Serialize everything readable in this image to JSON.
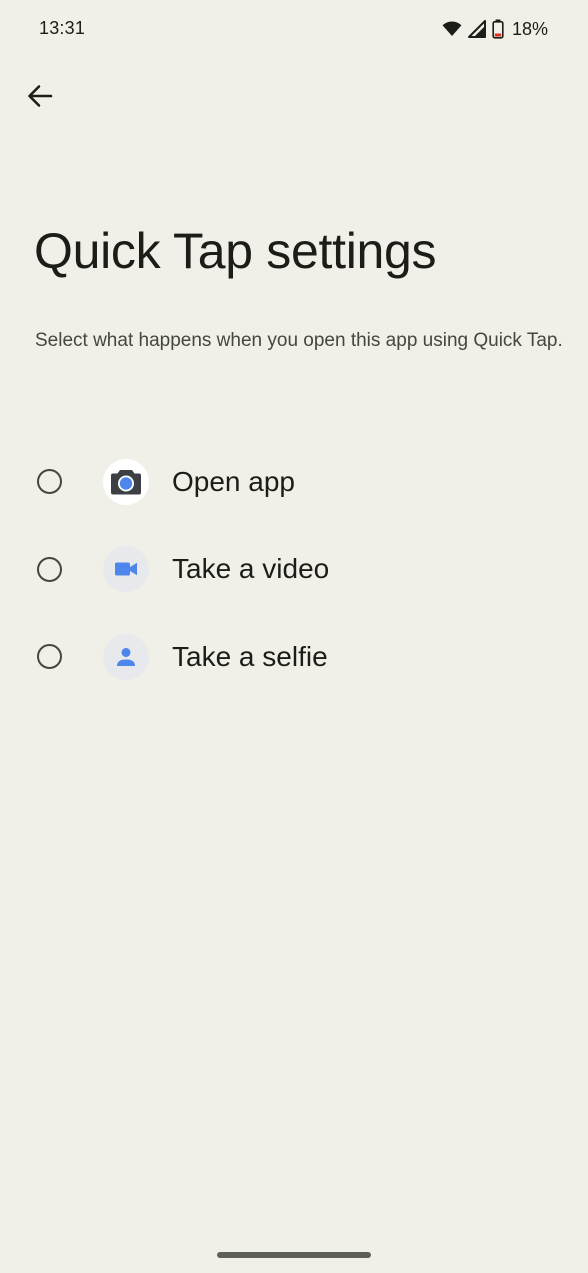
{
  "status_bar": {
    "time": "13:31",
    "battery_percent": "18%",
    "icons": [
      "wifi-icon",
      "cell-signal-icon",
      "battery-low-icon"
    ],
    "battery_color": "#d93025"
  },
  "header": {
    "back_icon": "arrow-back-icon"
  },
  "page": {
    "title": "Quick Tap settings",
    "description": "Select what happens when you open this app using Quick Tap."
  },
  "options": [
    {
      "label": "Open app",
      "icon": "camera-app-icon",
      "selected": false
    },
    {
      "label": "Take a video",
      "icon": "videocam-icon",
      "selected": false
    },
    {
      "label": "Take a selfie",
      "icon": "person-icon",
      "selected": false
    }
  ],
  "colors": {
    "background": "#f1f0e8",
    "accent_blue": "#4f86ec"
  }
}
